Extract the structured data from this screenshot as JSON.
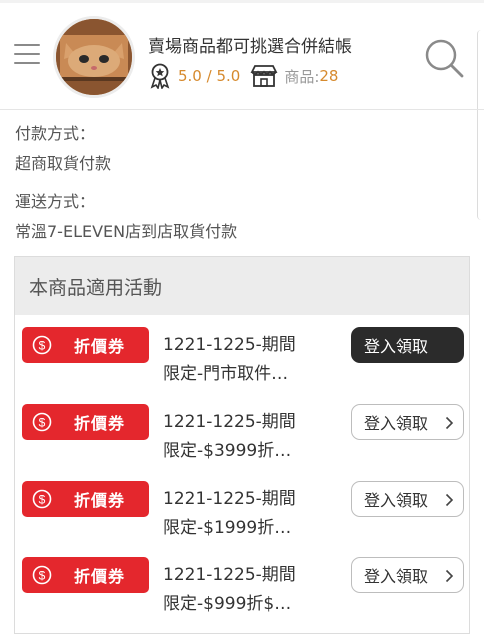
{
  "header": {
    "store_title": "賣場商品都可挑選合併結帳",
    "rating": "5.0 / 5.0",
    "goods_label": "商品:",
    "goods_count": "28"
  },
  "payment": {
    "label": "付款方式：",
    "value": "超商取貨付款"
  },
  "shipping": {
    "label": "運送方式：",
    "value": "常溫7-ELEVEN店到店取貨付款"
  },
  "promotions": {
    "title": "本商品適用活動",
    "items": [
      {
        "badge": "折價券",
        "line1": "1221-1225-期間",
        "line2": "限定-門市取件…",
        "button": "登入領取"
      },
      {
        "badge": "折價券",
        "line1": "1221-1225-期間",
        "line2": "限定-$3999折…",
        "button": "登入領取"
      },
      {
        "badge": "折價券",
        "line1": "1221-1225-期間",
        "line2": "限定-$1999折…",
        "button": "登入領取"
      },
      {
        "badge": "折價券",
        "line1": "1221-1225-期間",
        "line2": "限定-$999折$…",
        "button": "登入領取"
      }
    ]
  },
  "colors": {
    "accent_orange": "#d68a2e",
    "coupon_red": "#e4272d",
    "dark_button": "#2b2b2b"
  },
  "icons": [
    "menu-icon",
    "search-icon",
    "award-icon",
    "store-icon",
    "dollar-circle-icon",
    "chevron-right-icon"
  ]
}
